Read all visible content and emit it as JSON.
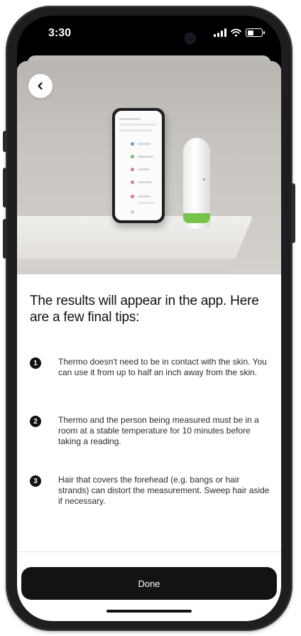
{
  "status_bar": {
    "time": "3:30",
    "icons": [
      "signal-icon",
      "wifi-icon",
      "battery-icon"
    ]
  },
  "header": {
    "back_icon": "chevron-left-icon"
  },
  "hero": {
    "image_subject": "phone-and-thermometer-photo",
    "accent_color": "#76c24a"
  },
  "content": {
    "title": "The results will appear in the app. Here are a few final tips:",
    "tips": [
      {
        "number": "1",
        "text": "Thermo doesn't need to be in contact with the skin. You can use it from up to half an inch away from the skin."
      },
      {
        "number": "2",
        "text": "Thermo and the person being measured must be in a room at a stable temperature for 10 minutes before taking a reading."
      },
      {
        "number": "3",
        "text": "Hair that covers the forehead (e.g. bangs or hair strands) can distort the measurement. Sweep hair aside if necessary."
      }
    ]
  },
  "footer": {
    "done_label": "Done"
  },
  "colors": {
    "button_bg": "#131313",
    "text": "#111111"
  }
}
